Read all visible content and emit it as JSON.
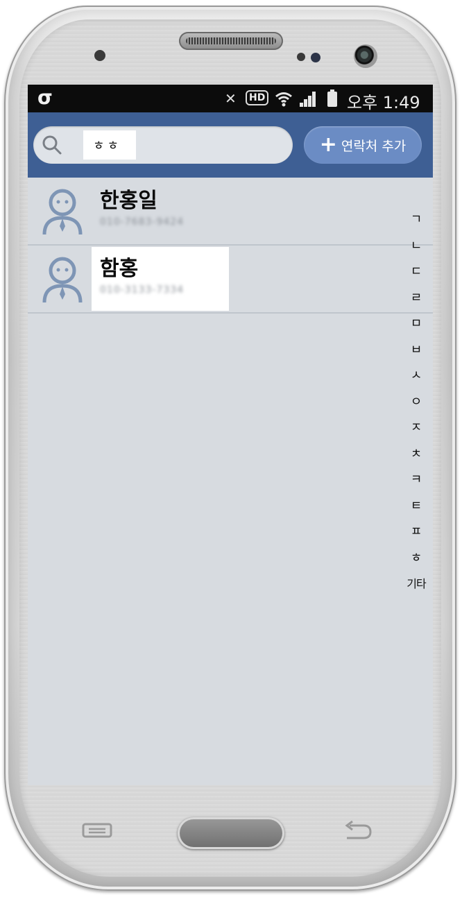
{
  "statusbar": {
    "carrier_logo": "σ",
    "icons": [
      "mute-icon",
      "hd-voice-icon",
      "wifi-icon",
      "signal-icon",
      "battery-icon"
    ],
    "hd_label": "HD",
    "time": "오후 1:49"
  },
  "search": {
    "value": "ㅎㅎ",
    "icon": "search-icon"
  },
  "toolbar": {
    "add_contact_label": "연락처 추가",
    "add_icon": "plus-icon"
  },
  "contacts": [
    {
      "name": "한홍일",
      "phone": "010-7683-9424"
    },
    {
      "name": "함홍",
      "phone": "010-3133-7334"
    }
  ],
  "index": [
    "ㄱ",
    "ㄴ",
    "ㄷ",
    "ㄹ",
    "ㅁ",
    "ㅂ",
    "ㅅ",
    "ㅇ",
    "ㅈ",
    "ㅊ",
    "ㅋ",
    "ㅌ",
    "ㅍ",
    "ㅎ",
    "기타"
  ],
  "colors": {
    "toolbar": "#3e5f94",
    "add_button": "#6b8cc4",
    "list_background": "#d7dbe0",
    "statusbar": "#0c0c0c",
    "avatar": "#7e95b5"
  }
}
